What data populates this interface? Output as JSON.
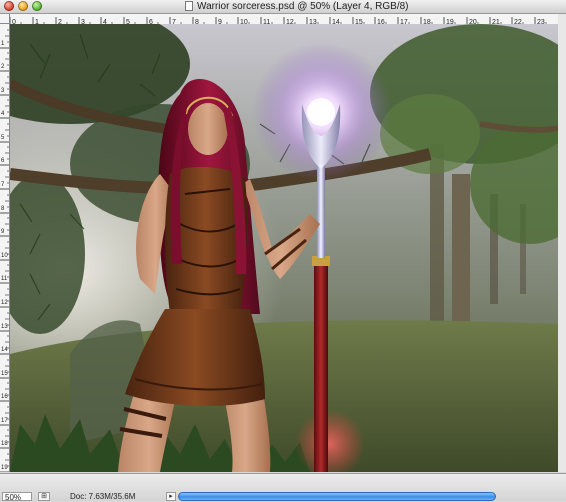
{
  "window": {
    "title": "Warrior sorceress.psd @ 50% (Layer 4, RGB/8)"
  },
  "ruler": {
    "top_labels": [
      "0",
      "1",
      "2",
      "3",
      "4",
      "5",
      "6",
      "7",
      "8",
      "9",
      "10",
      "11",
      "12",
      "13",
      "14",
      "15",
      "16",
      "17",
      "18",
      "19",
      "20",
      "21",
      "22",
      "23"
    ],
    "left_labels": [
      "1",
      "2",
      "3",
      "4",
      "5",
      "6",
      "7",
      "8",
      "9",
      "10",
      "11",
      "12",
      "13",
      "14",
      "15",
      "16",
      "17",
      "18",
      "19"
    ]
  },
  "canvas": {
    "description_layer": "Layer 4"
  },
  "status": {
    "zoom": "50%",
    "doc_info": "Doc: 7.63M/35.6M"
  },
  "colors": {
    "scroll_accent": "#3d8ee8",
    "orb_glow": "#e8c8ff",
    "hair": "#8a1030",
    "dress": "#6b3518"
  }
}
